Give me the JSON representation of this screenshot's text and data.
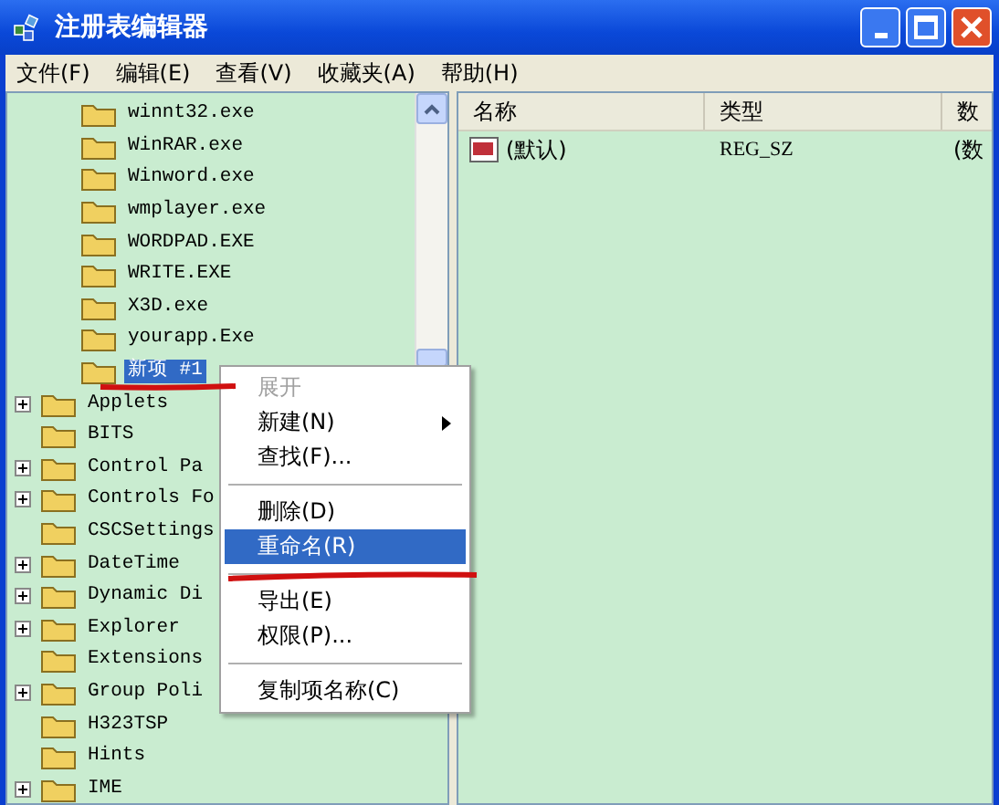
{
  "window": {
    "title": "注册表编辑器"
  },
  "menu_bar": [
    {
      "label": "文件(F)"
    },
    {
      "label": "编辑(E)"
    },
    {
      "label": "查看(V)"
    },
    {
      "label": "收藏夹(A)"
    },
    {
      "label": "帮助(H)"
    }
  ],
  "tree": {
    "nested_items": [
      {
        "label": "winnt32.exe",
        "selected": false
      },
      {
        "label": "WinRAR.exe",
        "selected": false
      },
      {
        "label": "Winword.exe",
        "selected": false
      },
      {
        "label": "wmplayer.exe",
        "selected": false
      },
      {
        "label": "WORDPAD.EXE",
        "selected": false
      },
      {
        "label": "WRITE.EXE",
        "selected": false
      },
      {
        "label": "X3D.exe",
        "selected": false
      },
      {
        "label": "yourapp.Exe",
        "selected": false
      },
      {
        "label": "新项 #1",
        "selected": true
      }
    ],
    "items": [
      {
        "label": "Applets",
        "expandable": true,
        "selected": false
      },
      {
        "label": "BITS",
        "expandable": false,
        "selected": false
      },
      {
        "label": "Control Pa",
        "expandable": true,
        "selected": false
      },
      {
        "label": "Controls Fo",
        "expandable": true,
        "selected": false
      },
      {
        "label": "CSCSettings",
        "expandable": false,
        "selected": false
      },
      {
        "label": "DateTime",
        "expandable": true,
        "selected": false
      },
      {
        "label": "Dynamic Di",
        "expandable": true,
        "selected": false
      },
      {
        "label": "Explorer",
        "expandable": true,
        "selected": false
      },
      {
        "label": "Extensions",
        "expandable": false,
        "selected": false
      },
      {
        "label": "Group Poli",
        "expandable": true,
        "selected": false
      },
      {
        "label": "H323TSP",
        "expandable": false,
        "selected": false
      },
      {
        "label": "Hints",
        "expandable": false,
        "selected": false
      },
      {
        "label": "IME",
        "expandable": true,
        "selected": false
      }
    ]
  },
  "values_table": {
    "columns": [
      "名称",
      "类型",
      "数"
    ],
    "rows": [
      [
        "(默认)",
        "REG_SZ",
        "(数"
      ]
    ]
  },
  "context_menu": [
    {
      "kind": "item",
      "label": "展开",
      "disabled": true,
      "selected": false,
      "submenu": false
    },
    {
      "kind": "item",
      "label": "新建(N)",
      "disabled": false,
      "selected": false,
      "submenu": true
    },
    {
      "kind": "item",
      "label": "查找(F)...",
      "disabled": false,
      "selected": false,
      "submenu": false
    },
    {
      "kind": "separator"
    },
    {
      "kind": "item",
      "label": "删除(D)",
      "disabled": false,
      "selected": false,
      "submenu": false
    },
    {
      "kind": "item",
      "label": "重命名(R)",
      "disabled": false,
      "selected": true,
      "submenu": false
    },
    {
      "kind": "separator"
    },
    {
      "kind": "item",
      "label": "导出(E)",
      "disabled": false,
      "selected": false,
      "submenu": false
    },
    {
      "kind": "item",
      "label": "权限(P)...",
      "disabled": false,
      "selected": false,
      "submenu": false
    },
    {
      "kind": "separator"
    },
    {
      "kind": "item",
      "label": "复制项名称(C)",
      "disabled": false,
      "selected": false,
      "submenu": false
    }
  ]
}
